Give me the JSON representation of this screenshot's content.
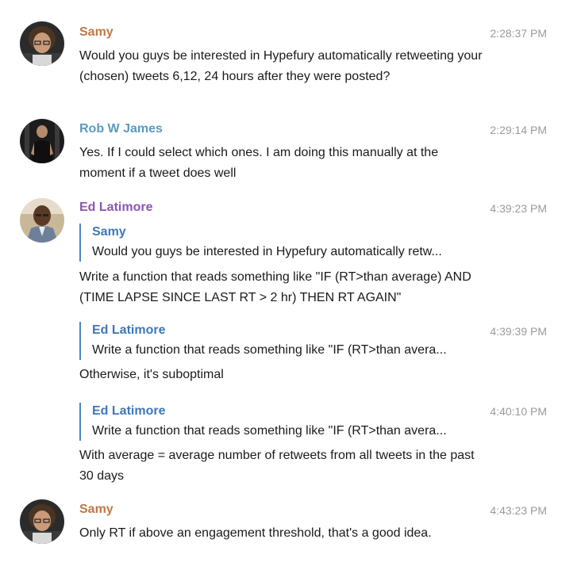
{
  "colors": {
    "samy": "#c07847",
    "rob": "#5a9bc0",
    "ed": "#8a56b0",
    "quote_name": "#3d78b8",
    "quote_bar": "#4f86c6",
    "timestamp": "#9a9a9a"
  },
  "messages": [
    {
      "sender": "Samy",
      "time": "2:28:37 PM",
      "text": "Would you guys be interested in Hypefury automatically retweeting your (chosen) tweets 6,12, 24 hours after they were posted?",
      "avatar": "samy-avatar"
    },
    {
      "sender": "Rob W James",
      "time": "2:29:14 PM",
      "text": "Yes. If I could select which ones. I am doing this manually at the moment if a tweet does well",
      "avatar": "rob-avatar"
    },
    {
      "sender": "Ed Latimore",
      "time": "4:39:23 PM",
      "quote": {
        "sender": "Samy",
        "text": "Would you guys be interested in Hypefury automatically retw..."
      },
      "text": "Write a function that reads something like \"IF (RT>than average) AND (TIME LAPSE SINCE LAST RT > 2 hr) THEN RT AGAIN\"",
      "avatar": "ed-avatar"
    },
    {
      "time": "4:39:39 PM",
      "quote": {
        "sender": "Ed Latimore",
        "text": "Write a function that reads something like \"IF (RT>than avera..."
      },
      "text": "Otherwise, it's suboptimal"
    },
    {
      "time": "4:40:10 PM",
      "quote": {
        "sender": "Ed Latimore",
        "text": "Write a function that reads something like \"IF (RT>than avera..."
      },
      "text": "With average = average number of retweets from all tweets in the past 30 days"
    },
    {
      "sender": "Samy",
      "time": "4:43:23 PM",
      "text": "Only RT if above an engagement threshold, that's a good idea.",
      "avatar": "samy-avatar"
    }
  ]
}
